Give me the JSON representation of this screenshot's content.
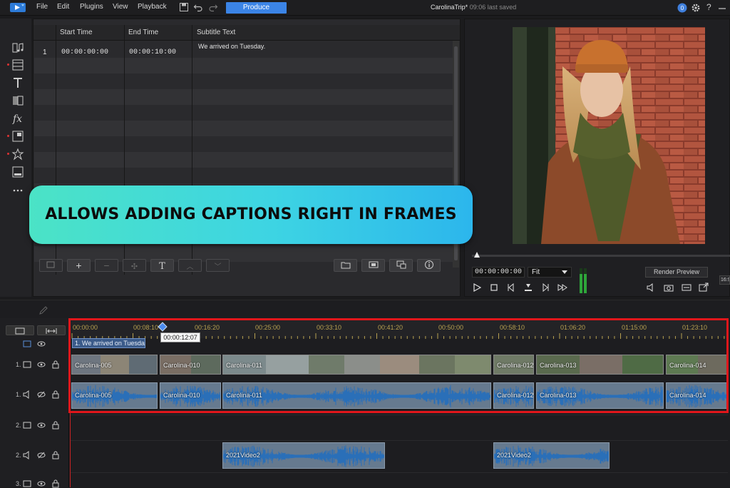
{
  "menubar": {
    "items": [
      "File",
      "Edit",
      "Plugins",
      "View",
      "Playback"
    ],
    "produce_label": "Produce",
    "project_name": "CarolinaTrip*",
    "save_status": "09:06 last saved",
    "help_label": "?"
  },
  "subtitle_table": {
    "headers": [
      "Start Time",
      "End Time",
      "Subtitle Text"
    ],
    "rows": [
      {
        "index": "1",
        "start": "00:00:00:00",
        "end": "00:00:10:00",
        "text": "We arrived on Tuesday."
      }
    ]
  },
  "preview": {
    "timecode": "00:00:00:00",
    "fit_option": "Fit",
    "render_label": "Render Preview",
    "side_label": "16:9"
  },
  "banner": {
    "text": "ALLOWS ADDING CAPTIONS RIGHT IN FRAMES",
    "colors": [
      "#4be3c6",
      "#2cb6ec"
    ]
  },
  "timeline": {
    "ruler_labels": [
      "00:00:00",
      "00:08:10",
      "00:16:20",
      "00:25:00",
      "00:33:10",
      "00:41:20",
      "00:50:00",
      "00:58:10",
      "01:06:20",
      "01:15:00",
      "01:23:10"
    ],
    "tooltip": "00:00:12:07",
    "caption_clip": "1. We arrived on Tuesda",
    "track_labels": [
      "1.",
      "1.",
      "2.",
      "2.",
      "3."
    ],
    "video_clips": [
      "Carolina-005",
      "Carolina-010",
      "Carolina-011",
      "Carolina-012",
      "Carolina-013",
      "Carolina-014"
    ],
    "audio_clips": [
      "Carolina-005",
      "Carolina-010",
      "Carolina-011",
      "Carolina-012",
      "Carolina-013",
      "Carolina-014"
    ],
    "audio2_clips": [
      "2021Video2",
      "2021Video2"
    ],
    "highlight_color": "#e0161b"
  }
}
